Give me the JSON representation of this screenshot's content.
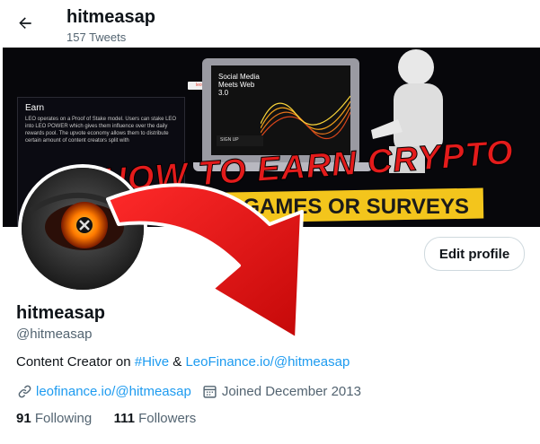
{
  "header": {
    "title": "hitmeasap",
    "tweet_count": "157 Tweets"
  },
  "banner": {
    "earn_title": "Earn",
    "earn_text": "LEO operates on a Proof of Stake model. Users can stake LEO into LEO POWER which gives them influence over the daily rewards pool. The upvote economy allows them to distribute certain amount of content creators split with",
    "mini_tag": "leofinance",
    "screen_title": "Social Media Meets Web 3.0",
    "screen_button": "SIGN UP",
    "headline_top": "HOW TO EARN CRYPTO",
    "headline_bottom": "EARN NO GAMES OR SURVEYS"
  },
  "profile": {
    "edit_label": "Edit profile",
    "name": "hitmeasap",
    "handle": "@hitmeasap",
    "bio_prefix": "Content Creator on ",
    "bio_hashtag": "#Hive",
    "bio_amp": " & ",
    "bio_link": "LeoFinance.io/@hitmeasap",
    "website": "leofinance.io/@hitmeasap",
    "joined": "Joined December 2013",
    "following_count": "91",
    "following_label": "Following",
    "followers_count": "111",
    "followers_label": "Followers"
  },
  "icons": {
    "back": "back-arrow-icon",
    "link": "link-icon",
    "calendar": "calendar-icon"
  },
  "colors": {
    "accent": "#1d9bf0",
    "text_primary": "#0f1419",
    "text_secondary": "#536471",
    "arrow_red": "#e01010"
  }
}
